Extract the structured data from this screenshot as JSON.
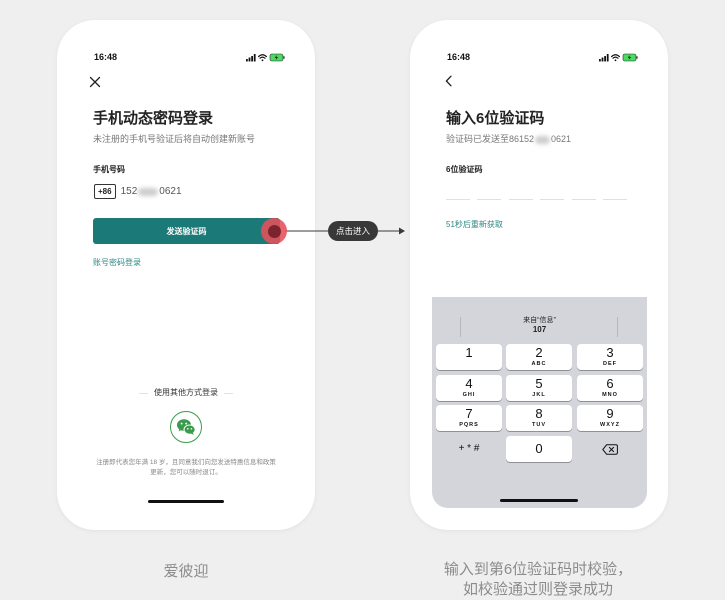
{
  "colors": {
    "page_background": "#efefef",
    "phone_background": "#ffffff",
    "accent": "#1b7a77",
    "link": "#2a8885",
    "tap_indicator": "#e74e5a",
    "keyboard_background": "#d3d5db",
    "wechat_green": "#3a9b4c",
    "battery_green": "#4cd964"
  },
  "left_phone": {
    "status_bar": {
      "time": "16:48",
      "icons": [
        "signal-icon",
        "wifi-icon",
        "battery-icon"
      ]
    },
    "close_icon": "close-icon",
    "title": "手机动态密码登录",
    "subtitle": "未注册的手机号验证后将自动创建新账号",
    "phone_field": {
      "label": "手机号码",
      "country_code": "+86",
      "value_start": "152",
      "value_end": "0621"
    },
    "send_button": "发送验证码",
    "password_login_link": "账号密码登录",
    "other_login": {
      "label": "使用其他方式登录",
      "icon": "wechat-icon"
    },
    "terms": "注册即代表您年满 18 岁，且同意我们向您发送特惠信息和政策更新，您可以随时退订。"
  },
  "annotation": {
    "label": "点击进入"
  },
  "right_phone": {
    "status_bar": {
      "time": "16:48",
      "icons": [
        "signal-icon",
        "wifi-icon",
        "battery-icon"
      ]
    },
    "back_icon": "chevron-left-icon",
    "title": "输入6位验证码",
    "subtitle_start": "验证码已发送至86152",
    "subtitle_end": "0621",
    "code_label": "6位验证码",
    "code_length": 6,
    "resend": "51秒后重新获取",
    "keyboard": {
      "suggestion": {
        "source": "来自“信息”",
        "code": "107"
      },
      "keys": [
        {
          "digit": "1"
        },
        {
          "digit": "2",
          "letters": "ABC"
        },
        {
          "digit": "3",
          "letters": "DEF"
        },
        {
          "digit": "4",
          "letters": "GHI"
        },
        {
          "digit": "5",
          "letters": "JKL"
        },
        {
          "digit": "6",
          "letters": "MNO"
        },
        {
          "digit": "7",
          "letters": "PQRS"
        },
        {
          "digit": "8",
          "letters": "TUV"
        },
        {
          "digit": "9",
          "letters": "WXYZ"
        }
      ],
      "symbols_key": "+ * #",
      "zero_key": "0",
      "delete_icon": "backspace-icon"
    }
  },
  "captions": {
    "left": "爱彼迎",
    "right": [
      "输入到第6位验证码时校验，",
      "如校验通过则登录成功"
    ]
  }
}
